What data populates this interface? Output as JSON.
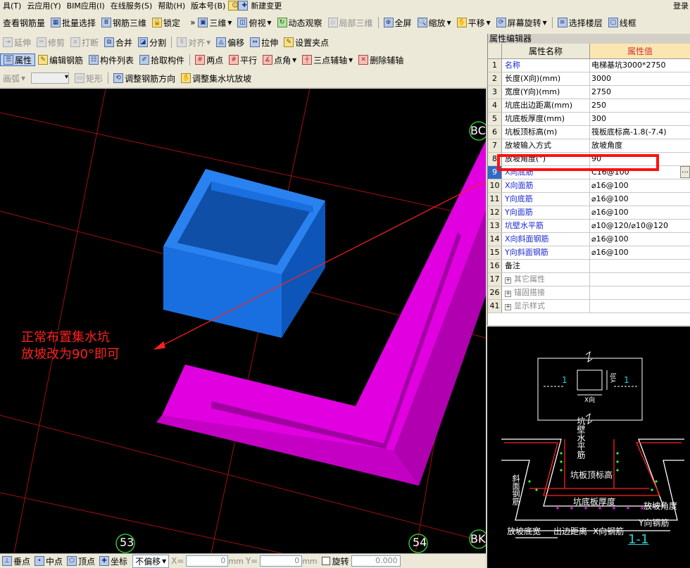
{
  "menu": [
    "具(T)",
    "云应用(Y)",
    "BIM应用(I)",
    "在线服务(S)",
    "帮助(H)",
    "版本号(B)",
    "新建变更"
  ],
  "login": "登录",
  "toolbar1": {
    "left": [
      "查看钢筋量",
      "批量选择",
      "钢筋三维",
      "锁定"
    ],
    "right": [
      "三维",
      "俯视",
      "动态观察",
      "局部三维",
      "全屏",
      "缩放",
      "平移",
      "屏幕旋转",
      "选择楼层",
      "线框"
    ]
  },
  "toolbar2": [
    "延伸",
    "修剪",
    "打断",
    "合并",
    "分割",
    "对齐",
    "偏移",
    "拉伸",
    "设置夹点"
  ],
  "toolbar3": [
    "属性",
    "编辑钢筋",
    "构件列表",
    "拾取构件",
    "两点",
    "平行",
    "点角",
    "三点辅轴",
    "删除辅轴"
  ],
  "toolbar4": [
    "画弧",
    "矩形",
    "调整钢筋方向",
    "调整集水坑放坡"
  ],
  "annotation": [
    "正常布置集水坑",
    "放坡改为90°即可"
  ],
  "axis_labels": [
    "53",
    "54",
    "BC",
    "BK"
  ],
  "status": {
    "items": [
      "垂点",
      "中点",
      "顶点",
      "坐标"
    ],
    "offset_mode": "不偏移",
    "x_label": "X=",
    "x_value": "0",
    "y_label": "Y=",
    "y_value": "0",
    "unit": "mm",
    "rotate_label": "旋转",
    "rotate_value": "0.000"
  },
  "prop_editor": {
    "title": "属性编辑器",
    "col_name": "属性名称",
    "col_value": "属性值",
    "rows": [
      {
        "no": "1",
        "name": "名称",
        "value": "电梯基坑3000*2750",
        "style": "blue"
      },
      {
        "no": "2",
        "name": "长度(X向)(mm)",
        "value": "3000",
        "style": ""
      },
      {
        "no": "3",
        "name": "宽度(Y向)(mm)",
        "value": "2750",
        "style": ""
      },
      {
        "no": "4",
        "name": "坑底出边距离(mm)",
        "value": "250",
        "style": ""
      },
      {
        "no": "5",
        "name": "坑底板厚度(mm)",
        "value": "300",
        "style": ""
      },
      {
        "no": "6",
        "name": "坑板顶标高(m)",
        "value": "筏板底标高-1.8(-7.4)",
        "style": ""
      },
      {
        "no": "7",
        "name": "放坡输入方式",
        "value": "放坡角度",
        "style": ""
      },
      {
        "no": "8",
        "name": "放坡角度(°)",
        "value": "90",
        "style": ""
      },
      {
        "no": "9",
        "name": "X向底筋",
        "value": "C16@100",
        "style": "blue active"
      },
      {
        "no": "10",
        "name": "X向面筋",
        "value": "⌀16@100",
        "style": "blue"
      },
      {
        "no": "11",
        "name": "Y向底筋",
        "value": "⌀16@100",
        "style": "blue"
      },
      {
        "no": "12",
        "name": "Y向面筋",
        "value": "⌀16@100",
        "style": "blue"
      },
      {
        "no": "13",
        "name": "坑壁水平筋",
        "value": "⌀10@120/⌀10@120",
        "style": "blue"
      },
      {
        "no": "14",
        "name": "X向斜面钢筋",
        "value": "⌀16@100",
        "style": "blue"
      },
      {
        "no": "15",
        "name": "Y向斜面钢筋",
        "value": "⌀16@100",
        "style": "blue"
      },
      {
        "no": "16",
        "name": "备注",
        "value": "",
        "style": ""
      },
      {
        "no": "17",
        "name": "其它属性",
        "value": "",
        "style": "group"
      },
      {
        "no": "26",
        "name": "锚固搭接",
        "value": "",
        "style": "group"
      },
      {
        "no": "41",
        "name": "显示样式",
        "value": "",
        "style": "group"
      }
    ]
  },
  "detail": {
    "sec_label": "1",
    "x_dir": "X向",
    "y_dir": "Y向",
    "wall_rebar": "坑壁水平筋",
    "top_elev": "坑板顶标高",
    "slope_rebar": "斜面钢筋",
    "bottom_thk": "坑底板厚度",
    "slope_angle": "放坡角度",
    "y_rebar": "Y向钢筋",
    "slope_width": "放坡底宽",
    "edge_dist": "出边距离",
    "x_rebar": "X向钢筋",
    "section_title": "1-1"
  },
  "colors": {
    "pit": "#1a6fe0",
    "slab": "#ff00ff",
    "grid": "#b01010",
    "annotation": "#ff2020",
    "highlight": "#ff1010"
  }
}
